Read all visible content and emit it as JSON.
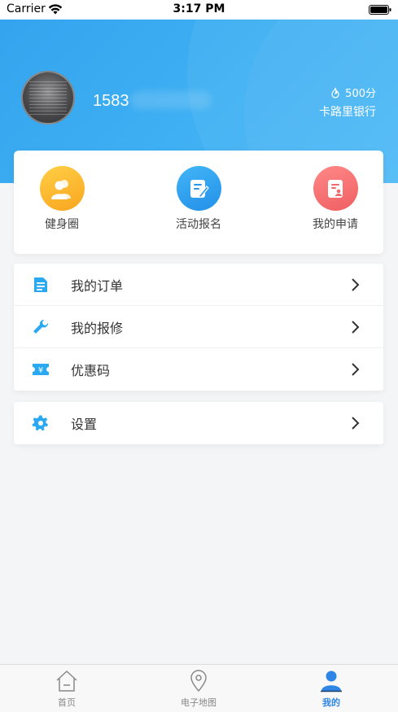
{
  "status_bar": {
    "carrier": "Carrier",
    "time": "3:17 PM"
  },
  "profile": {
    "username": "1583",
    "points": "500分",
    "bank": "卡路里银行",
    "avatar_icon": "avatar-photo"
  },
  "quick_actions": [
    {
      "label": "健身圈",
      "icon": "people-icon",
      "color": "#f9a51f"
    },
    {
      "label": "活动报名",
      "icon": "edit-note-icon",
      "color": "#2390e8"
    },
    {
      "label": "我的申请",
      "icon": "application-icon",
      "color": "#ef5f62"
    }
  ],
  "menu": [
    {
      "label": "我的订单",
      "icon": "document-icon"
    },
    {
      "label": "我的报修",
      "icon": "wrench-icon"
    },
    {
      "label": "优惠码",
      "icon": "coupon-icon"
    }
  ],
  "settings": {
    "label": "设置",
    "icon": "gear-icon"
  },
  "tabbar": [
    {
      "label": "首页",
      "icon": "home-icon",
      "active": false
    },
    {
      "label": "电子地图",
      "icon": "map-pin-icon",
      "active": false
    },
    {
      "label": "我的",
      "icon": "user-icon",
      "active": true
    }
  ],
  "colors": {
    "primary": "#3aa8f0",
    "active_tab": "#2f86e6",
    "icon_blue": "#2aa8f2"
  }
}
